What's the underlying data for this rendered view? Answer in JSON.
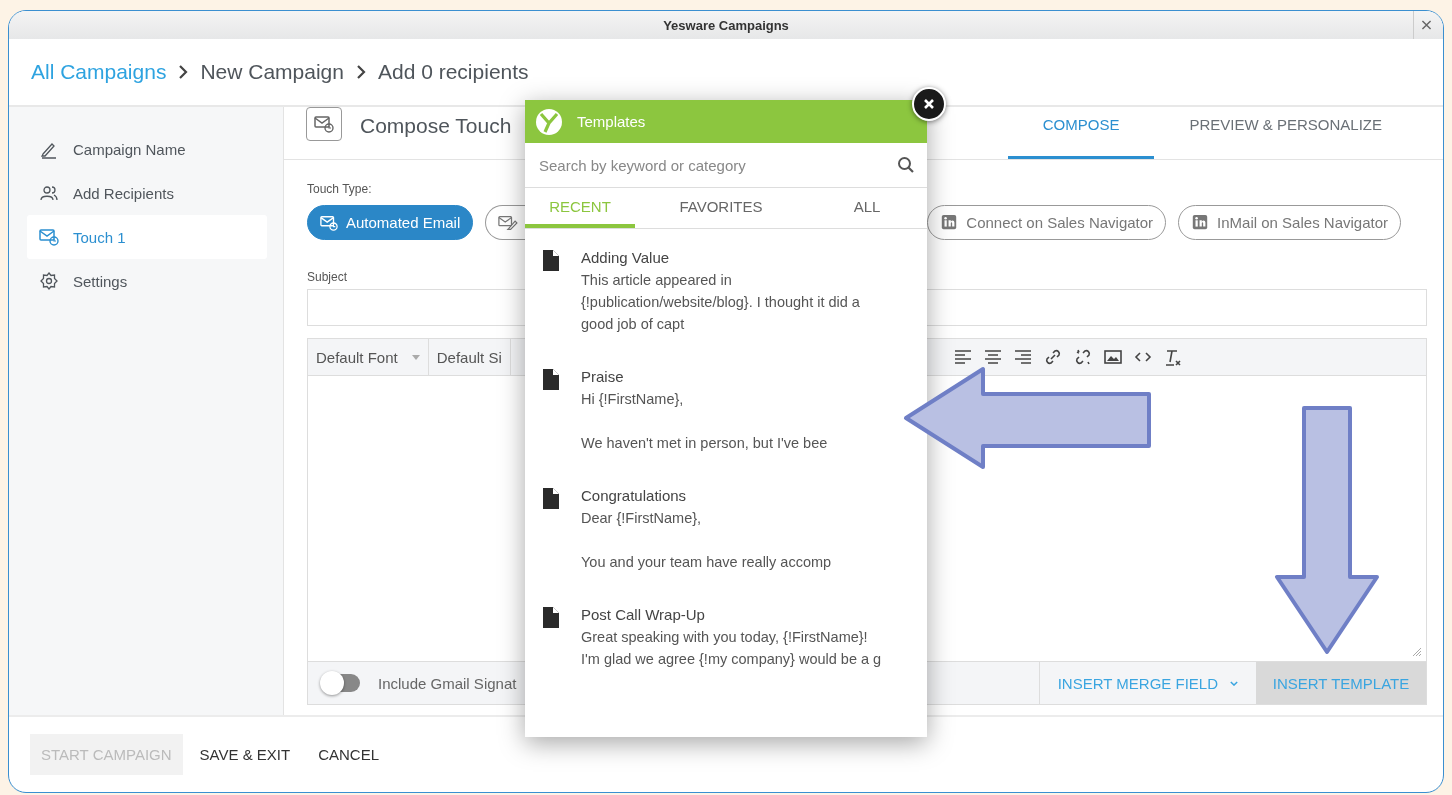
{
  "window": {
    "title": "Yesware Campaigns"
  },
  "breadcrumb": [
    {
      "label": "All Campaigns",
      "kind": "link"
    },
    {
      "label": "New Campaign",
      "kind": "text"
    },
    {
      "label": "Add 0 recipients",
      "kind": "text"
    }
  ],
  "sidebar": {
    "items": [
      {
        "label": "Campaign Name",
        "kind": "pencil",
        "selected": false
      },
      {
        "label": "Add Recipients",
        "kind": "people",
        "selected": false
      },
      {
        "label": "Touch 1",
        "kind": "mail",
        "selected": true
      },
      {
        "label": "Settings",
        "kind": "gear",
        "selected": false
      }
    ]
  },
  "compose": {
    "title": "Compose Touch",
    "tabs": [
      {
        "label": "COMPOSE",
        "selected": true
      },
      {
        "label": "PREVIEW & PERSONALIZE",
        "selected": false
      }
    ]
  },
  "touch_type": {
    "label": "Touch Type:",
    "options": [
      {
        "label": "Automated Email",
        "kind": "mail",
        "selected": true
      },
      {
        "kind": "mail-edit",
        "selected": false
      },
      {
        "label": "Connect on Sales Navigator",
        "kind": "linkedin",
        "selected": false
      },
      {
        "label": "InMail on Sales Navigator",
        "kind": "linkedin",
        "selected": false
      }
    ]
  },
  "subject": {
    "label": "Subject"
  },
  "editor": {
    "font": "Default Font",
    "size": "Default Si",
    "signature": {
      "label": "Include Gmail Signat",
      "on": false
    },
    "merge_field": "INSERT MERGE FIELD",
    "insert_template": "INSERT TEMPLATE"
  },
  "actions": [
    {
      "label": "START CAMPAIGN",
      "disabled": true
    },
    {
      "label": "SAVE & EXIT",
      "disabled": false
    },
    {
      "label": "CANCEL",
      "disabled": false
    }
  ],
  "templates": {
    "title": "Templates",
    "search": {
      "placeholder": "Search by keyword or category"
    },
    "tabs": [
      {
        "label": "RECENT",
        "selected": true
      },
      {
        "label": "FAVORITES",
        "selected": false
      },
      {
        "label": "ALL",
        "selected": false
      }
    ],
    "items": [
      {
        "title": "Adding Value",
        "body": "This article appeared in\n{!publication/website/blog}. I thought it did a\ngood job of capt"
      },
      {
        "title": "Praise",
        "body": "Hi {!FirstName},\n\nWe haven't met in person, but I've bee"
      },
      {
        "title": "Congratulations",
        "body": "Dear {!FirstName},\n\nYou and your team have really accomp"
      },
      {
        "title": "Post Call Wrap-Up",
        "body": "Great speaking with you today, {!FirstName}!\nI'm glad we agree {!my company} would be a g"
      }
    ]
  },
  "annotations": [
    {
      "kind": "left"
    },
    {
      "kind": "down"
    }
  ]
}
